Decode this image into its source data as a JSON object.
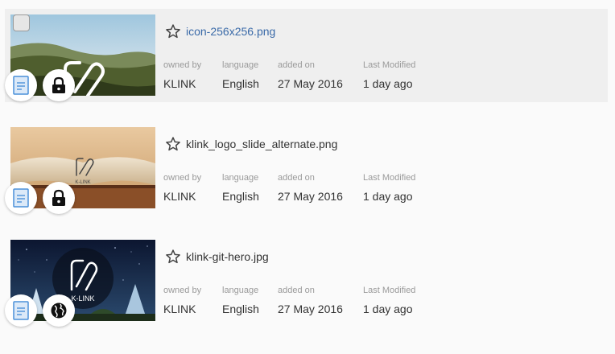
{
  "labels": {
    "owned_by": "owned by",
    "language": "language",
    "added_on": "added on",
    "last_modified": "Last Modified"
  },
  "items": [
    {
      "title": "icon-256x256.png",
      "owner": "KLINK",
      "language": "English",
      "added_on": "27 May 2016",
      "last_modified": "1 day ago",
      "selected": true,
      "access": "private",
      "access_icon": "lock-icon"
    },
    {
      "title": "klink_logo_slide_alternate.png",
      "owner": "KLINK",
      "language": "English",
      "added_on": "27 May 2016",
      "last_modified": "1 day ago",
      "selected": false,
      "access": "private",
      "access_icon": "lock-icon"
    },
    {
      "title": "klink-git-hero.jpg",
      "owner": "KLINK",
      "language": "English",
      "added_on": "27 May 2016",
      "last_modified": "1 day ago",
      "selected": false,
      "access": "public",
      "access_icon": "globe-icon"
    }
  ],
  "thumb_logo_text": "K-LINK",
  "colors": {
    "link": "#3a6aa8",
    "doc_icon": "#4a90d9",
    "selected_row_bg": "#efefef"
  }
}
